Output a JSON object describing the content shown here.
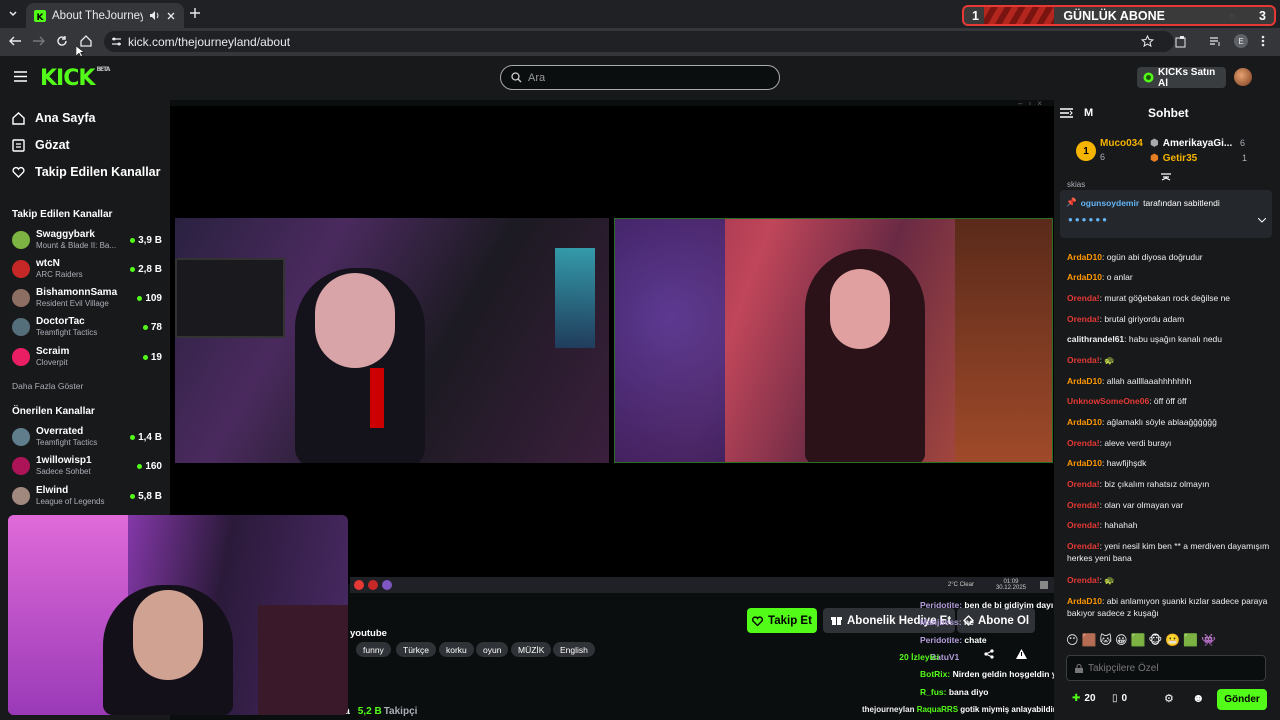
{
  "browser": {
    "tab_title": "About TheJourneyLand - W",
    "url": "kick.com/thejourneyland/about",
    "profile_initial": "E"
  },
  "sub_banner": {
    "left": "1",
    "label": "GÜNLÜK ABONE",
    "right": "3"
  },
  "kick": {
    "logo": "KICK",
    "logo_beta": "BETA",
    "search_placeholder": "Ara",
    "buy_kicks": "KICKs Satın Al"
  },
  "sidebar": {
    "nav": [
      {
        "label": "Ana Sayfa",
        "icon": "home-icon"
      },
      {
        "label": "Gözat",
        "icon": "browse-icon"
      },
      {
        "label": "Takip Edilen Kanallar",
        "icon": "heart-icon"
      }
    ],
    "followed_title": "Takip Edilen Kanallar",
    "followed": [
      {
        "name": "Swaggybark",
        "game": "Mount & Blade II: Ba...",
        "viewers": "3,9 B",
        "color": "#7cb342"
      },
      {
        "name": "wtcN",
        "game": "ARC Raiders",
        "viewers": "2,8 B",
        "color": "#c62828"
      },
      {
        "name": "BishamonnSama",
        "game": "Resident Evil Village",
        "viewers": "109",
        "color": "#8d6e63"
      },
      {
        "name": "DoctorTac",
        "game": "Teamfight Tactics",
        "viewers": "78",
        "color": "#546e7a"
      },
      {
        "name": "Scraim",
        "game": "Cloverpit",
        "viewers": "19",
        "color": "#e91e63"
      }
    ],
    "show_more": "Daha Fazla Göster",
    "recommended_title": "Önerilen Kanallar",
    "recommended": [
      {
        "name": "Overrated",
        "game": "Teamfight Tactics",
        "viewers": "1,4 B",
        "color": "#607d8b"
      },
      {
        "name": "1willowisp1",
        "game": "Sadece Sohbet",
        "viewers": "160",
        "color": "#ad1457"
      },
      {
        "name": "Elwind",
        "game": "League of Legends",
        "viewers": "5,8 B",
        "color": "#a1887f"
      }
    ]
  },
  "stream": {
    "taskbar_weather": "2°C Clear",
    "taskbar_time": "01:09",
    "taskbar_date": "30.12.2025",
    "category_fragment": "youtube",
    "tags": [
      "funny",
      "Türkçe",
      "korku",
      "oyun",
      "MÜZİK",
      "English"
    ],
    "follower_name_fragment": "nda",
    "followers": "5,2 B",
    "followers_label": "Takipçi",
    "follow_button": "Takip Et",
    "gift_button": "Abonelik Hediye Et",
    "subscribe_button": "Abone Ol",
    "overlay_chat": [
      {
        "user": "Peridotite",
        "text": "ben de bi gidiyim dayı",
        "color": "#b39ddb"
      },
      {
        "user": "Mahjbess",
        "text": "ne",
        "color": "#b39ddb"
      },
      {
        "user": "Peridotite",
        "text": "chate",
        "color": "#b39ddb"
      },
      {
        "user": "BatuV1",
        "text": "",
        "color": "#b39ddb"
      },
      {
        "user": "BotRix",
        "text": "Nirden geldin hoşgeldin yauv",
        "color": "#53fc18"
      },
      {
        "user": "R_fus",
        "text": "bana diyo",
        "color": "#53fc18"
      },
      {
        "user": "RaquaRRS",
        "text": "gotik miymiş anlayabildin mi?",
        "color": "#53fc18"
      }
    ],
    "overlay_views": "20",
    "overlay_views_label": "İzleyici",
    "overlay_handle": "thejourneylan",
    "overlay_handle_suffix": "Tarafından"
  },
  "chat": {
    "menu_letter": "M",
    "title": "Sohbet",
    "leaderboard": [
      {
        "rank": "1",
        "name": "Muco034",
        "count": "6"
      },
      {
        "name": "AmerikayaGi...",
        "count": "6"
      },
      {
        "name": "Getir35",
        "count": "1"
      }
    ],
    "pinned_by_user": "ogunsoydemir",
    "pinned_by_text": "tarafından sabitlendi",
    "top_fragment": "skias",
    "messages": [
      {
        "user": "ArdaD10",
        "text": "ogün abi diyosa doğrudur",
        "color": "#ff9800"
      },
      {
        "user": "ArdaD10",
        "text": "o anlar",
        "color": "#ff9800"
      },
      {
        "user": "Orenda!",
        "text": "murat göğebakan rock değilse ne",
        "color": "#e53935"
      },
      {
        "user": "Orenda!",
        "text": "brutal giriyordu adam",
        "color": "#e53935"
      },
      {
        "user": "calithrandel61",
        "text": "habu uşağın kanalı nedu",
        "color": "#efeff1"
      },
      {
        "user": "Orenda!",
        "text": "🐢",
        "color": "#e53935"
      },
      {
        "user": "ArdaD10",
        "text": "allah aallllaaahhhhhhh",
        "color": "#ff9800"
      },
      {
        "user": "UnknowSomeOne06",
        "text": "öff öff öff",
        "color": "#e53935"
      },
      {
        "user": "ArdaD10",
        "text": "ağlamaklı söyle ablaağğğğğğ",
        "color": "#ff9800"
      },
      {
        "user": "Orenda!",
        "text": "aleve verdi burayı",
        "color": "#e53935"
      },
      {
        "user": "ArdaD10",
        "text": "hawfijhşdk",
        "color": "#ff9800"
      },
      {
        "user": "Orenda!",
        "text": "biz çıkalım rahatsız olmayın",
        "color": "#e53935"
      },
      {
        "user": "Orenda!",
        "text": "olan var olmayan var",
        "color": "#e53935"
      },
      {
        "user": "Orenda!",
        "text": "hahahah",
        "color": "#e53935"
      },
      {
        "user": "Orenda!",
        "text": "yeni nesil kim ben ** a merdiven dayamışım herkes yeni bana",
        "color": "#e53935"
      },
      {
        "user": "Orenda!",
        "text": "🐢",
        "color": "#e53935"
      },
      {
        "user": "ArdaD10",
        "text": "abi anlamıyon şuanki kızlar sadece paraya bakıyor sadece z kuşağı",
        "color": "#ff9800"
      }
    ],
    "input_placeholder": "Takipçilere Özel",
    "points": "20",
    "count": "0",
    "send": "Gönder"
  }
}
